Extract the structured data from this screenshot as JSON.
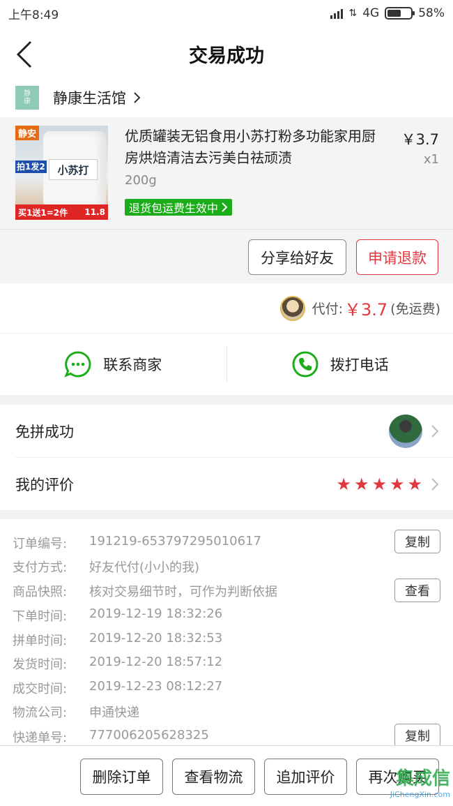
{
  "status_bar": {
    "time": "上午8:49",
    "network": "4G",
    "battery_text": "58%",
    "battery_level": 0.58
  },
  "header": {
    "title": "交易成功"
  },
  "shop": {
    "logo_text": "静\n康",
    "name": "静康生活馆"
  },
  "product": {
    "title": "优质罐装无铝食用小苏打粉多功能家用厨房烘焙清洁去污美白祛顽渍",
    "spec": "200g",
    "price": "￥3.7",
    "quantity": "x1",
    "return_badge": "退货包运费生效中",
    "image": {
      "brand": "静安",
      "promo": "拍1发2",
      "jar_label": "小苏打",
      "bottom_left": "买1送1=2件",
      "bottom_right": "11.8"
    }
  },
  "actions": {
    "share": "分享给好友",
    "refund": "申请退款"
  },
  "payment": {
    "label": "代付:",
    "amount": "￥3.7",
    "note": "(免运费)"
  },
  "contact": {
    "merchant": "联系商家",
    "call": "拨打电话"
  },
  "rows": {
    "group": "免拼成功",
    "review": "我的评价",
    "rating": 5
  },
  "order": {
    "fields": [
      {
        "key": "订单编号:",
        "value": "191219-653797295010617"
      },
      {
        "key": "支付方式:",
        "value": "好友代付(小小的我)"
      },
      {
        "key": "商品快照:",
        "value": "核对交易细节时，可作为判断依据"
      },
      {
        "key": "下单时间:",
        "value": "2019-12-19 18:32:26"
      },
      {
        "key": "拼单时间:",
        "value": "2019-12-20 18:32:53"
      },
      {
        "key": "发货时间:",
        "value": "2019-12-20 18:57:12"
      },
      {
        "key": "成交时间:",
        "value": "2019-12-23 08:12:27"
      },
      {
        "key": "物流公司:",
        "value": "申通快递"
      },
      {
        "key": "快递单号:",
        "value": "777006205628325"
      }
    ],
    "copy_label": "复制",
    "view_label": "查看"
  },
  "bottom": {
    "delete": "删除订单",
    "logistics": "查看物流",
    "add_review": "追加评价",
    "rebuy": "再次购买"
  },
  "watermark": {
    "main": "集成信",
    "sub": "JiChengXin.com"
  },
  "colors": {
    "accent": "#e0383e",
    "green": "#1aad19",
    "contact_green": "#1aad19"
  }
}
